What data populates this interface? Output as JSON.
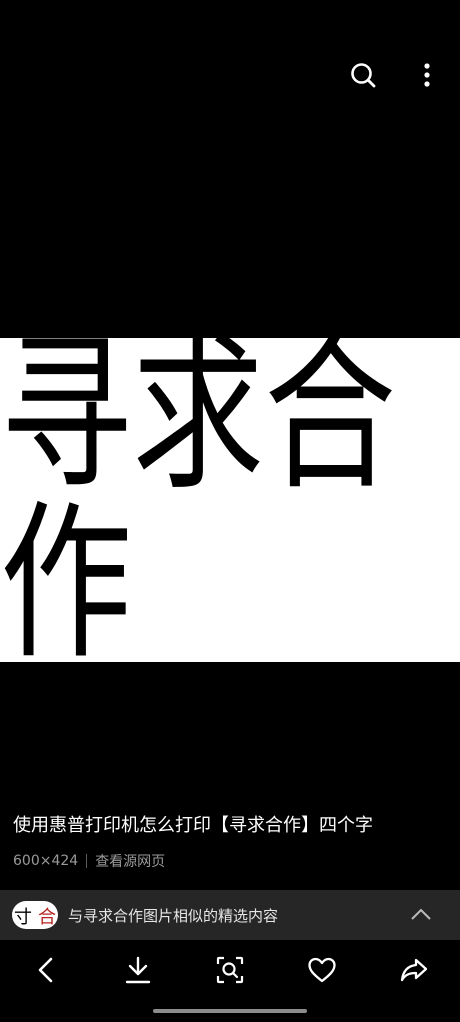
{
  "header": {
    "search_icon": "search-icon",
    "more_icon": "more-vertical-icon"
  },
  "image": {
    "text": "寻求合作"
  },
  "info": {
    "title": "使用惠普打印机怎么打印【寻求合作】四个字",
    "dimensions": "600×424",
    "view_source": "查看源网页"
  },
  "similar": {
    "thumb_text_1": "寸",
    "thumb_text_2": "合",
    "label": "与寻求合作图片相似的精选内容"
  },
  "bottom_nav": {
    "icons": [
      "back-icon",
      "download-icon",
      "lens-search-icon",
      "heart-icon",
      "share-icon"
    ]
  },
  "colors": {
    "background": "#000000",
    "bar": "#262626",
    "meta_text": "#9a9a9a"
  }
}
